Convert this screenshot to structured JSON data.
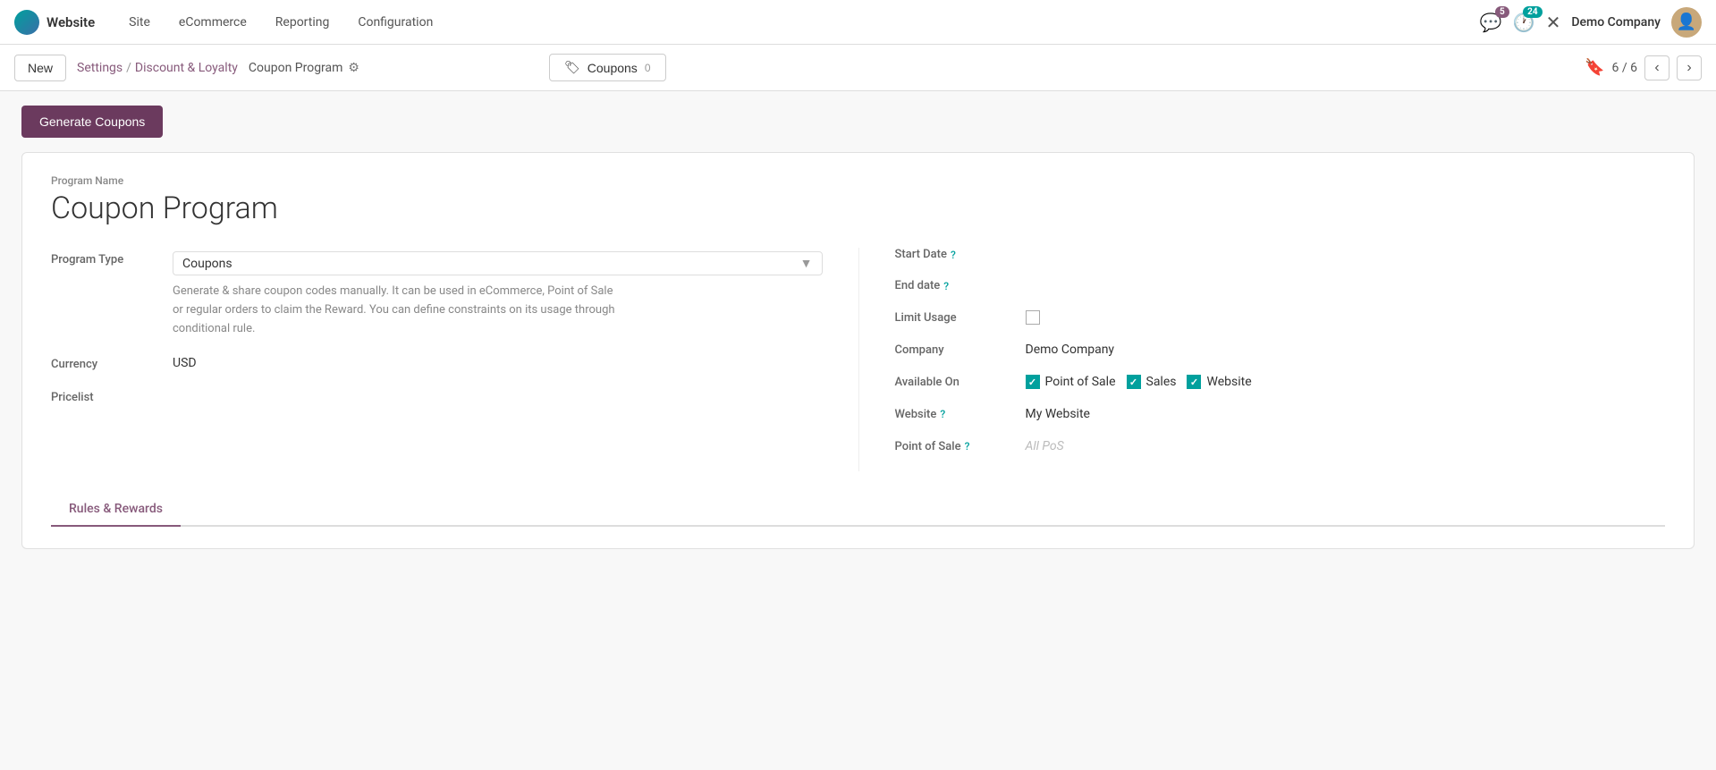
{
  "app": {
    "logo_text": "Website",
    "nav_items": [
      "Site",
      "eCommerce",
      "Reporting",
      "Configuration"
    ],
    "notifications_chat_count": "5",
    "notifications_activity_count": "24",
    "company_name": "Demo Company",
    "avatar_emoji": "👤"
  },
  "breadcrumb": {
    "new_label": "New",
    "settings_label": "Settings",
    "separator": "/",
    "discount_loyalty_label": "Discount & Loyalty",
    "current_label": "Coupon Program"
  },
  "coupons_button": {
    "label": "Coupons",
    "count": "0"
  },
  "pagination": {
    "current": "6",
    "total": "6"
  },
  "actions": {
    "generate_coupons_label": "Generate Coupons"
  },
  "form": {
    "program_name_label": "Program Name",
    "program_name_value": "Coupon Program",
    "program_type_label": "Program Type",
    "program_type_value": "Coupons",
    "program_type_description": "Generate & share coupon codes manually. It can be used in eCommerce, Point of Sale or regular orders to claim the Reward. You can define constraints on its usage through conditional rule.",
    "currency_label": "Currency",
    "currency_value": "USD",
    "pricelist_label": "Pricelist",
    "pricelist_value": "",
    "start_date_label": "Start Date",
    "end_date_label": "End date",
    "limit_usage_label": "Limit Usage",
    "company_label": "Company",
    "company_value": "Demo Company",
    "available_on_label": "Available On",
    "available_on_pos": "Point of Sale",
    "available_on_sales": "Sales",
    "available_on_website": "Website",
    "website_label": "Website",
    "website_value": "My Website",
    "point_of_sale_label": "Point of Sale",
    "point_of_sale_placeholder": "All PoS"
  },
  "tabs": {
    "rules_rewards_label": "Rules & Rewards"
  },
  "icons": {
    "chat": "💬",
    "activity": "🕐",
    "wrench": "✕",
    "bookmark": "🔖",
    "tag": "🏷",
    "gear": "⚙",
    "chevron_left": "‹",
    "chevron_right": "›"
  }
}
